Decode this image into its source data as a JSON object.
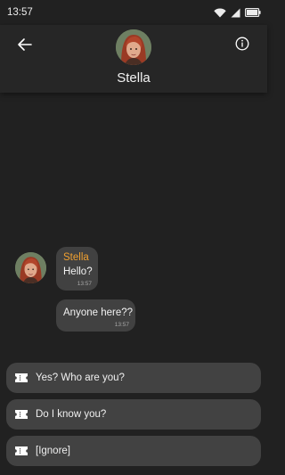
{
  "status_bar": {
    "time": "13:57"
  },
  "header": {
    "contact_name": "Stella",
    "icons": [
      "back-arrow-icon",
      "contact-avatar",
      "info-icon"
    ]
  },
  "messages": [
    {
      "sender": "Stella",
      "text": "Hello?",
      "time": "13:57"
    },
    {
      "text": "Anyone here??",
      "time": "13:57"
    }
  ],
  "replies": [
    {
      "label": "Yes? Who are you?",
      "icon": "ticket-icon"
    },
    {
      "label": "Do I know you?",
      "icon": "ticket-icon"
    },
    {
      "label": "[Ignore]",
      "icon": "ticket-icon"
    }
  ],
  "colors": {
    "background": "#212121",
    "header": "#262626",
    "bubble": "#414141",
    "reply_button": "#424242",
    "sender_name": "#f0a030"
  }
}
